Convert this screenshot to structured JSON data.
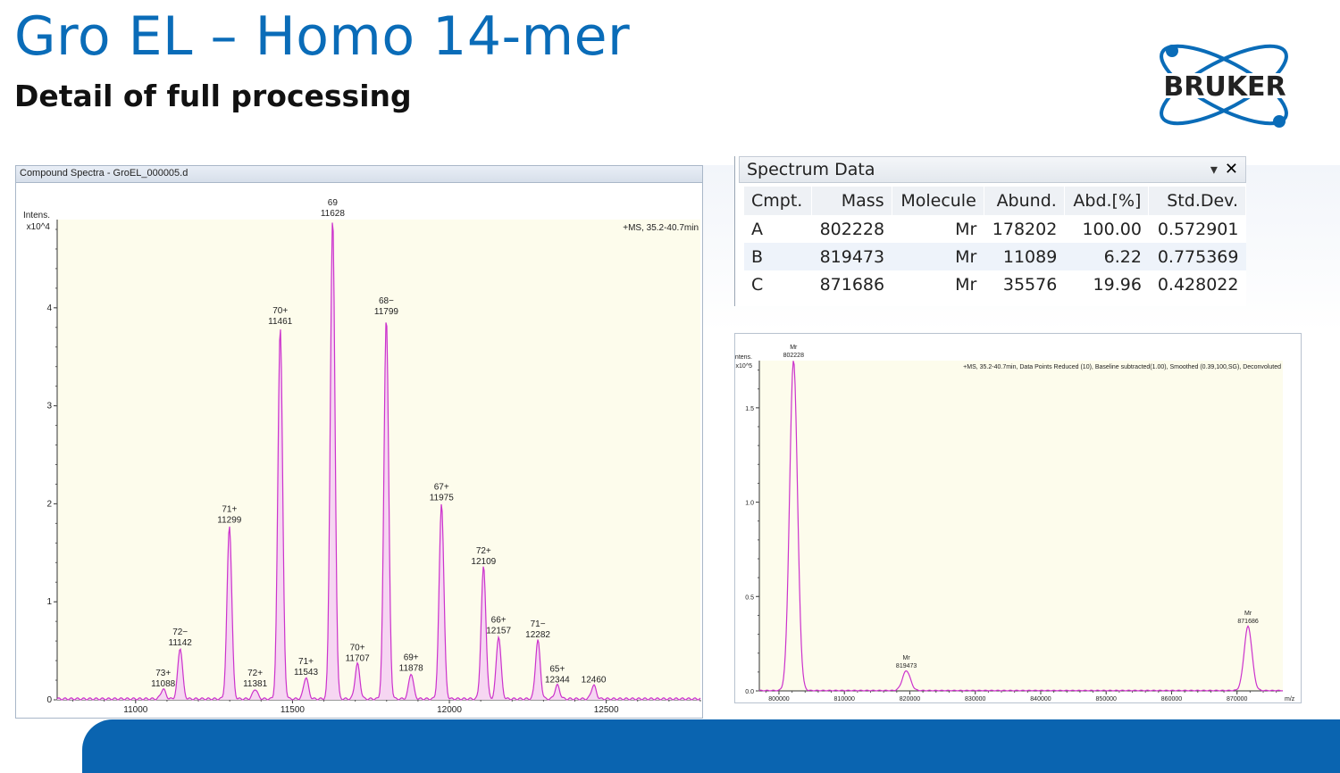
{
  "slide": {
    "title": "Gro EL – Homo 14-mer",
    "subtitle": "Detail of full processing",
    "logo_text": "BRUKER",
    "colors": {
      "title": "#0a6cb8",
      "footer": "#0a64b0",
      "trace": "#cc33cc",
      "trace_fill": "#f6d6f2",
      "plot_bg": "#fdfcec"
    }
  },
  "compound_window": {
    "title": "Compound Spectra - GroEL_000005.d"
  },
  "spectrum_table": {
    "title": "Spectrum Data",
    "columns": [
      "Cmpt.",
      "Mass",
      "Molecule",
      "Abund.",
      "Abd.[%]",
      "Std.Dev."
    ],
    "rows": [
      [
        "A",
        "802228",
        "Mr",
        "178202",
        "100.00",
        "0.572901"
      ],
      [
        "B",
        "819473",
        "Mr",
        "11089",
        "6.22",
        "0.775369"
      ],
      [
        "C",
        "871686",
        "Mr",
        "35576",
        "19.96",
        "0.428022"
      ]
    ]
  },
  "chart_data": [
    {
      "type": "line",
      "title": "+MS, 35.2-40.7min",
      "ylabel": "Intens. x10^4",
      "xlabel": "",
      "xlim": [
        10750,
        12800
      ],
      "ylim": [
        0,
        4.9
      ],
      "xticks": [
        11000,
        11500,
        12000,
        12500
      ],
      "yticks": [
        0,
        1,
        2,
        3,
        4
      ],
      "peaks": [
        {
          "x": 11088,
          "y": 0.1,
          "label": "73+",
          "value": "11088"
        },
        {
          "x": 11142,
          "y": 0.52,
          "label": "72−",
          "value": "11142"
        },
        {
          "x": 11299,
          "y": 1.77,
          "label": "71+",
          "value": "11299"
        },
        {
          "x": 11381,
          "y": 0.1,
          "label": "72+",
          "value": "11381"
        },
        {
          "x": 11461,
          "y": 3.8,
          "label": "70+",
          "value": "11461"
        },
        {
          "x": 11543,
          "y": 0.22,
          "label": "71+",
          "value": "11543"
        },
        {
          "x": 11628,
          "y": 4.9,
          "label": "69",
          "value": "11628"
        },
        {
          "x": 11707,
          "y": 0.36,
          "label": "70+",
          "value": "11707"
        },
        {
          "x": 11799,
          "y": 3.9,
          "label": "68−",
          "value": "11799"
        },
        {
          "x": 11878,
          "y": 0.26,
          "label": "69+",
          "value": "11878"
        },
        {
          "x": 11975,
          "y": 2.0,
          "label": "67+",
          "value": "11975"
        },
        {
          "x": 12109,
          "y": 1.35,
          "label": "72+",
          "value": "12109"
        },
        {
          "x": 12157,
          "y": 0.64,
          "label": "66+",
          "value": "12157"
        },
        {
          "x": 12282,
          "y": 0.6,
          "label": "71−",
          "value": "12282"
        },
        {
          "x": 12344,
          "y": 0.14,
          "label": "65+",
          "value": "12344"
        },
        {
          "x": 12460,
          "y": 0.14,
          "label": "",
          "value": "12460"
        }
      ]
    },
    {
      "type": "line",
      "title": "+MS, 35.2-40.7min, Data Points Reduced (10), Baseline subtracted(1.00), Smoothed (0.39,100,SG), Deconvoluted",
      "ylabel": "Intens. x10^5",
      "xlabel": "m/z",
      "xlim": [
        797000,
        877000
      ],
      "ylim": [
        0,
        1.75
      ],
      "xticks": [
        800000,
        810000,
        820000,
        830000,
        840000,
        850000,
        860000,
        870000
      ],
      "yticks": [
        0.0,
        0.5,
        1.0,
        1.5
      ],
      "peaks": [
        {
          "x": 802228,
          "y": 1.75,
          "label": "Mr",
          "value": "802228"
        },
        {
          "x": 819473,
          "y": 0.105,
          "label": "Mr",
          "value": "819473"
        },
        {
          "x": 871686,
          "y": 0.34,
          "label": "Mr",
          "value": "871686"
        }
      ]
    }
  ]
}
